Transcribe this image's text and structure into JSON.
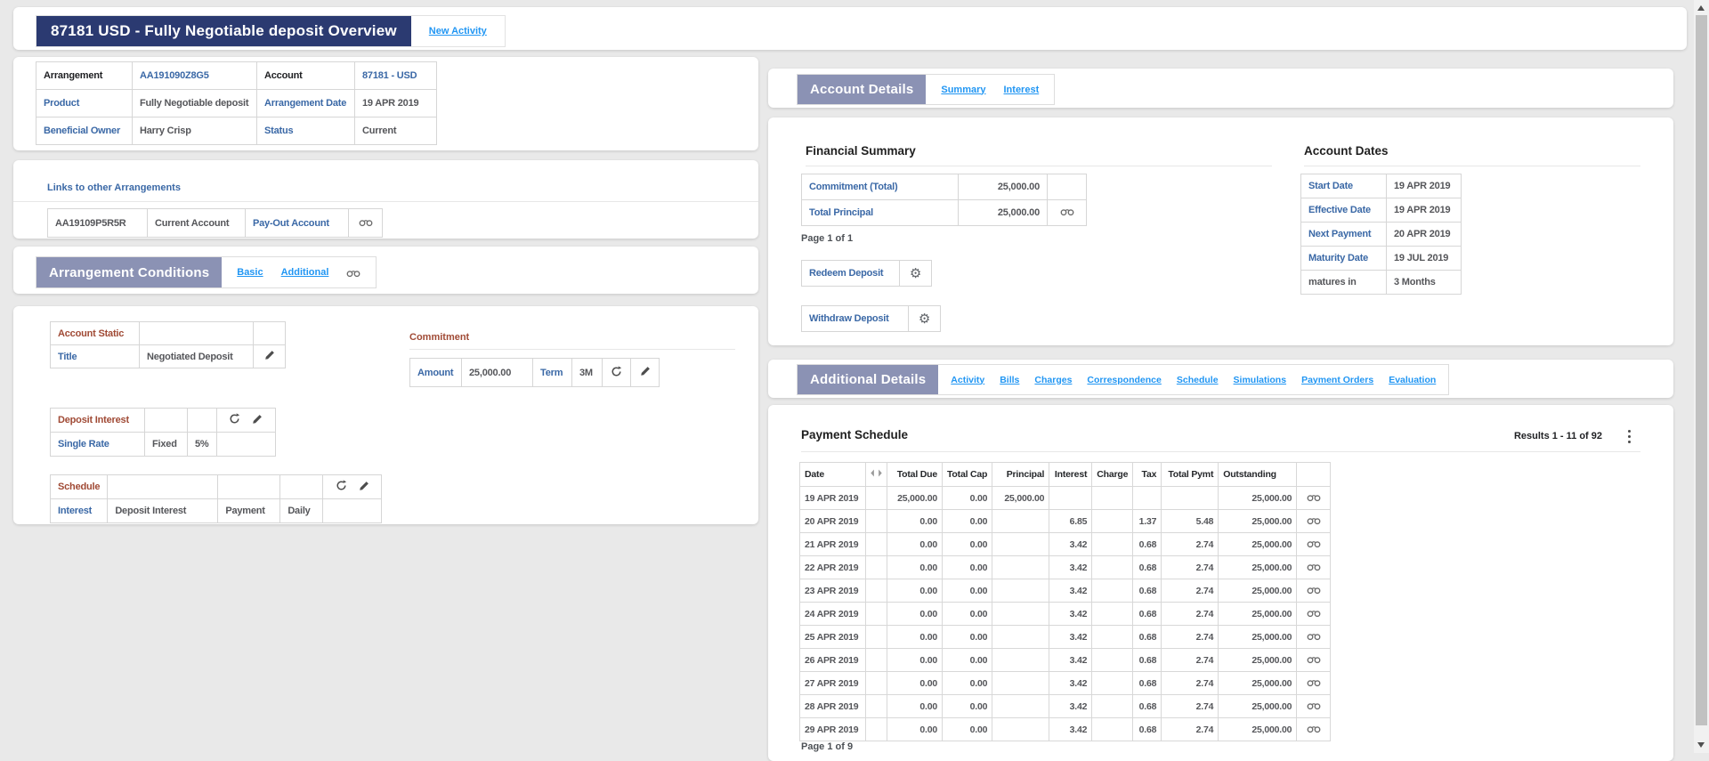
{
  "colors": {
    "banner_navy": "#2b3a71",
    "section_header": "#8b92b4",
    "bright_link_blue": "#2196f3",
    "label_blue": "#3a68a6",
    "condition_maroon": "#a04a35",
    "value_gray": "#55565a",
    "page_background": "#e9e9e9"
  },
  "icons": {
    "view": "binoculars-icon",
    "edit": "pencil-icon",
    "recalc": "refresh-circular-arrow-icon",
    "actions": "gear-icon",
    "more": "kebab-vertical-dots-icon",
    "column_resize": "left-right-triangles-icon"
  },
  "header": {
    "title": "87181 USD - Fully Negotiable deposit Overview",
    "new_activity": "New Activity"
  },
  "arrangement_info": {
    "rows": [
      {
        "l1": "Arrangement",
        "v1": "AA191090Z8G5",
        "l2": "Account",
        "v2": "87181 - USD"
      },
      {
        "l1": "Product",
        "v1": "Fully Negotiable deposit",
        "l2": "Arrangement Date",
        "v2": "19 APR 2019"
      },
      {
        "l1": "Beneficial Owner",
        "v1": "Harry Crisp",
        "l2": "Status",
        "v2": "Current"
      }
    ]
  },
  "links_section": {
    "title": "Links to other Arrangements",
    "cells": [
      "AA19109P5R5R",
      "Current Account",
      "Pay-Out Account"
    ]
  },
  "arrangement_conditions": {
    "title": "Arrangement Conditions",
    "tabs": [
      "Basic",
      "Additional"
    ]
  },
  "account_static": {
    "title": "Account Static",
    "row_label": "Title",
    "row_value": "Negotiated Deposit"
  },
  "commitment": {
    "title": "Commitment",
    "amount_label": "Amount",
    "amount_value": "25,000.00",
    "term_label": "Term",
    "term_value": "3M"
  },
  "deposit_interest": {
    "title": "Deposit Interest",
    "row_label": "Single Rate",
    "type": "Fixed",
    "rate": "5%"
  },
  "schedule_conditions": {
    "title": "Schedule",
    "row_label": "Interest",
    "cells": [
      "Deposit Interest",
      "Payment",
      "Daily"
    ]
  },
  "account_details": {
    "title": "Account Details",
    "tabs": [
      "Summary",
      "Interest"
    ]
  },
  "financial_summary": {
    "title": "Financial Summary",
    "rows": [
      {
        "label": "Commitment (Total)",
        "value": "25,000.00"
      },
      {
        "label": "Total Principal",
        "value": "25,000.00"
      }
    ],
    "page": "Page 1 of 1",
    "buttons": [
      "Redeem Deposit",
      "Withdraw Deposit"
    ]
  },
  "account_dates": {
    "title": "Account Dates",
    "rows": [
      [
        "Start Date",
        "19 APR 2019"
      ],
      [
        "Effective Date",
        "19 APR 2019"
      ],
      [
        "Next Payment",
        "20 APR 2019"
      ],
      [
        "Maturity Date",
        "19 JUL 2019"
      ],
      [
        "matures in",
        "3 Months"
      ]
    ]
  },
  "additional_details": {
    "title": "Additional Details",
    "tabs": [
      "Activity",
      "Bills",
      "Charges",
      "Correspondence",
      "Schedule",
      "Simulations",
      "Payment Orders",
      "Evaluation"
    ]
  },
  "payment_schedule": {
    "title": "Payment Schedule",
    "results": "Results 1 - 11 of 92",
    "columns": [
      "Date",
      "Total Due",
      "Total Cap",
      "Principal",
      "Interest",
      "Charge",
      "Tax",
      "Total Pymt",
      "Outstanding"
    ],
    "rows": [
      [
        "19 APR 2019",
        "25,000.00",
        "0.00",
        "25,000.00",
        "",
        "",
        "",
        "",
        "25,000.00"
      ],
      [
        "20 APR 2019",
        "0.00",
        "0.00",
        "",
        "6.85",
        "",
        "1.37",
        "5.48",
        "25,000.00"
      ],
      [
        "21 APR 2019",
        "0.00",
        "0.00",
        "",
        "3.42",
        "",
        "0.68",
        "2.74",
        "25,000.00"
      ],
      [
        "22 APR 2019",
        "0.00",
        "0.00",
        "",
        "3.42",
        "",
        "0.68",
        "2.74",
        "25,000.00"
      ],
      [
        "23 APR 2019",
        "0.00",
        "0.00",
        "",
        "3.42",
        "",
        "0.68",
        "2.74",
        "25,000.00"
      ],
      [
        "24 APR 2019",
        "0.00",
        "0.00",
        "",
        "3.42",
        "",
        "0.68",
        "2.74",
        "25,000.00"
      ],
      [
        "25 APR 2019",
        "0.00",
        "0.00",
        "",
        "3.42",
        "",
        "0.68",
        "2.74",
        "25,000.00"
      ],
      [
        "26 APR 2019",
        "0.00",
        "0.00",
        "",
        "3.42",
        "",
        "0.68",
        "2.74",
        "25,000.00"
      ],
      [
        "27 APR 2019",
        "0.00",
        "0.00",
        "",
        "3.42",
        "",
        "0.68",
        "2.74",
        "25,000.00"
      ],
      [
        "28 APR 2019",
        "0.00",
        "0.00",
        "",
        "3.42",
        "",
        "0.68",
        "2.74",
        "25,000.00"
      ],
      [
        "29 APR 2019",
        "0.00",
        "0.00",
        "",
        "3.42",
        "",
        "0.68",
        "2.74",
        "25,000.00"
      ]
    ],
    "page": "Page 1 of 9"
  }
}
